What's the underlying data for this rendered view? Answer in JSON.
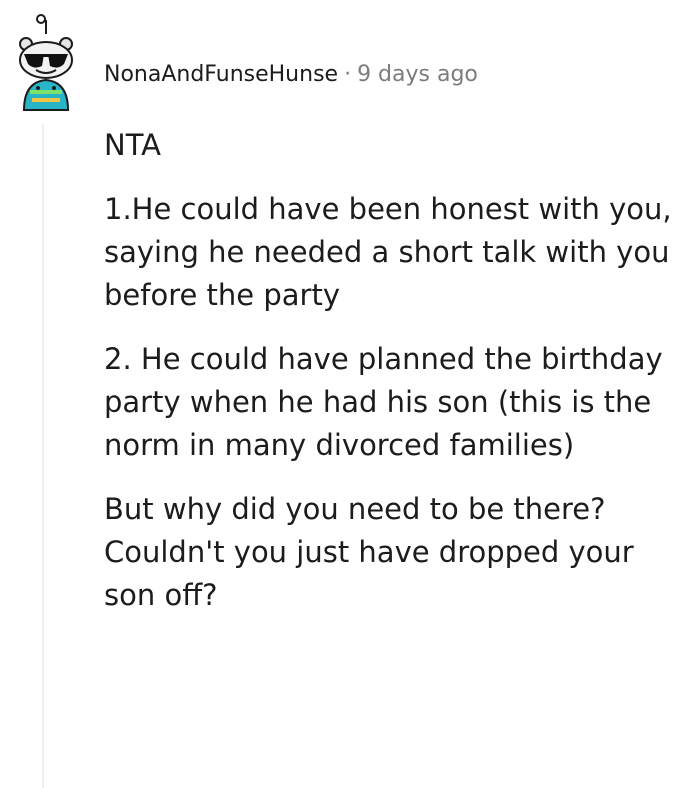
{
  "comment": {
    "username": "NonaAndFunseHunse",
    "separator": "·",
    "timestamp": "9 days ago",
    "paragraphs": [
      "NTA",
      "1.He could have been honest with you, saying he needed a short talk with you before the party",
      "2. He could have planned the birthday party when he had his son (this is the norm in many divorced families)",
      "But why did you need to be there? Couldn't you just have dropped your son off?"
    ]
  }
}
